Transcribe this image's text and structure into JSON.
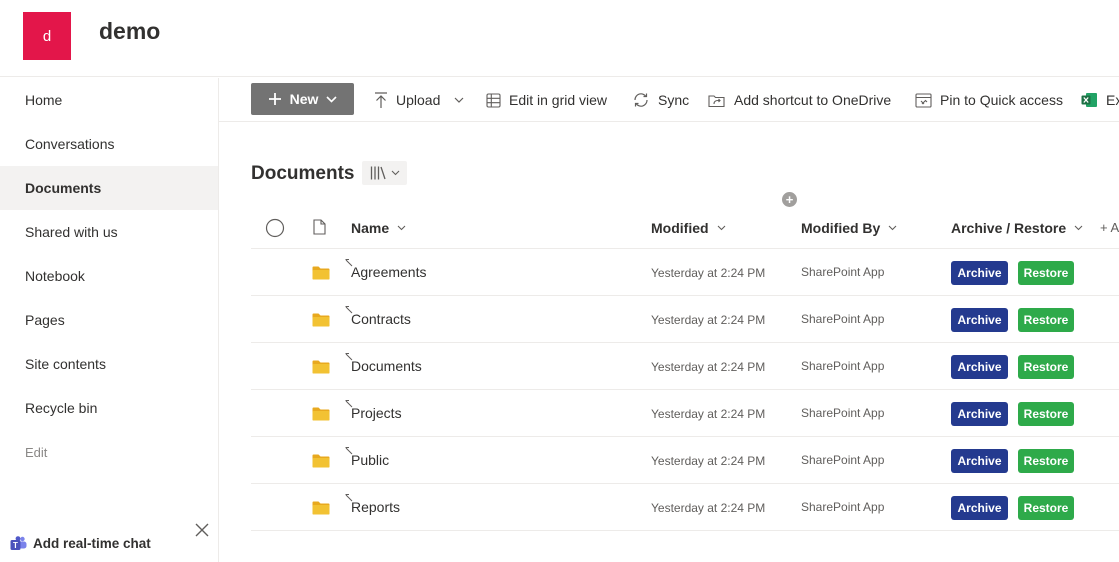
{
  "site": {
    "logo_letter": "d",
    "title": "demo"
  },
  "nav": {
    "items": [
      {
        "label": "Home"
      },
      {
        "label": "Conversations"
      },
      {
        "label": "Documents"
      },
      {
        "label": "Shared with us"
      },
      {
        "label": "Notebook"
      },
      {
        "label": "Pages"
      },
      {
        "label": "Site contents"
      },
      {
        "label": "Recycle bin"
      }
    ],
    "edit_label": "Edit",
    "active_item": "Documents",
    "chat_label": "Add real-time chat"
  },
  "command_bar": {
    "new_label": "New",
    "upload_label": "Upload",
    "grid_label": "Edit in grid view",
    "sync_label": "Sync",
    "shortcut_label": "Add shortcut to OneDrive",
    "pin_label": "Pin to Quick access",
    "excel_label": "Ex"
  },
  "library": {
    "title": "Documents",
    "columns": {
      "name": "Name",
      "modified": "Modified",
      "modified_by": "Modified By",
      "archive_restore": "Archive / Restore"
    },
    "add_column_label": "+ A",
    "archive_label": "Archive",
    "restore_label": "Restore",
    "rows": [
      {
        "name": "Agreements",
        "modified": "Yesterday at 2:24 PM",
        "modified_by": "SharePoint App"
      },
      {
        "name": "Contracts",
        "modified": "Yesterday at 2:24 PM",
        "modified_by": "SharePoint App"
      },
      {
        "name": "Documents",
        "modified": "Yesterday at 2:24 PM",
        "modified_by": "SharePoint App"
      },
      {
        "name": "Projects",
        "modified": "Yesterday at 2:24 PM",
        "modified_by": "SharePoint App"
      },
      {
        "name": "Public",
        "modified": "Yesterday at 2:24 PM",
        "modified_by": "SharePoint App"
      },
      {
        "name": "Reports",
        "modified": "Yesterday at 2:24 PM",
        "modified_by": "SharePoint App"
      }
    ]
  },
  "colors": {
    "logo": "#e3164a",
    "new_button": "#737373",
    "archive": "#243a8f",
    "restore": "#2eaa4a",
    "folder": "#f2c233",
    "excel": "#1d7044"
  }
}
